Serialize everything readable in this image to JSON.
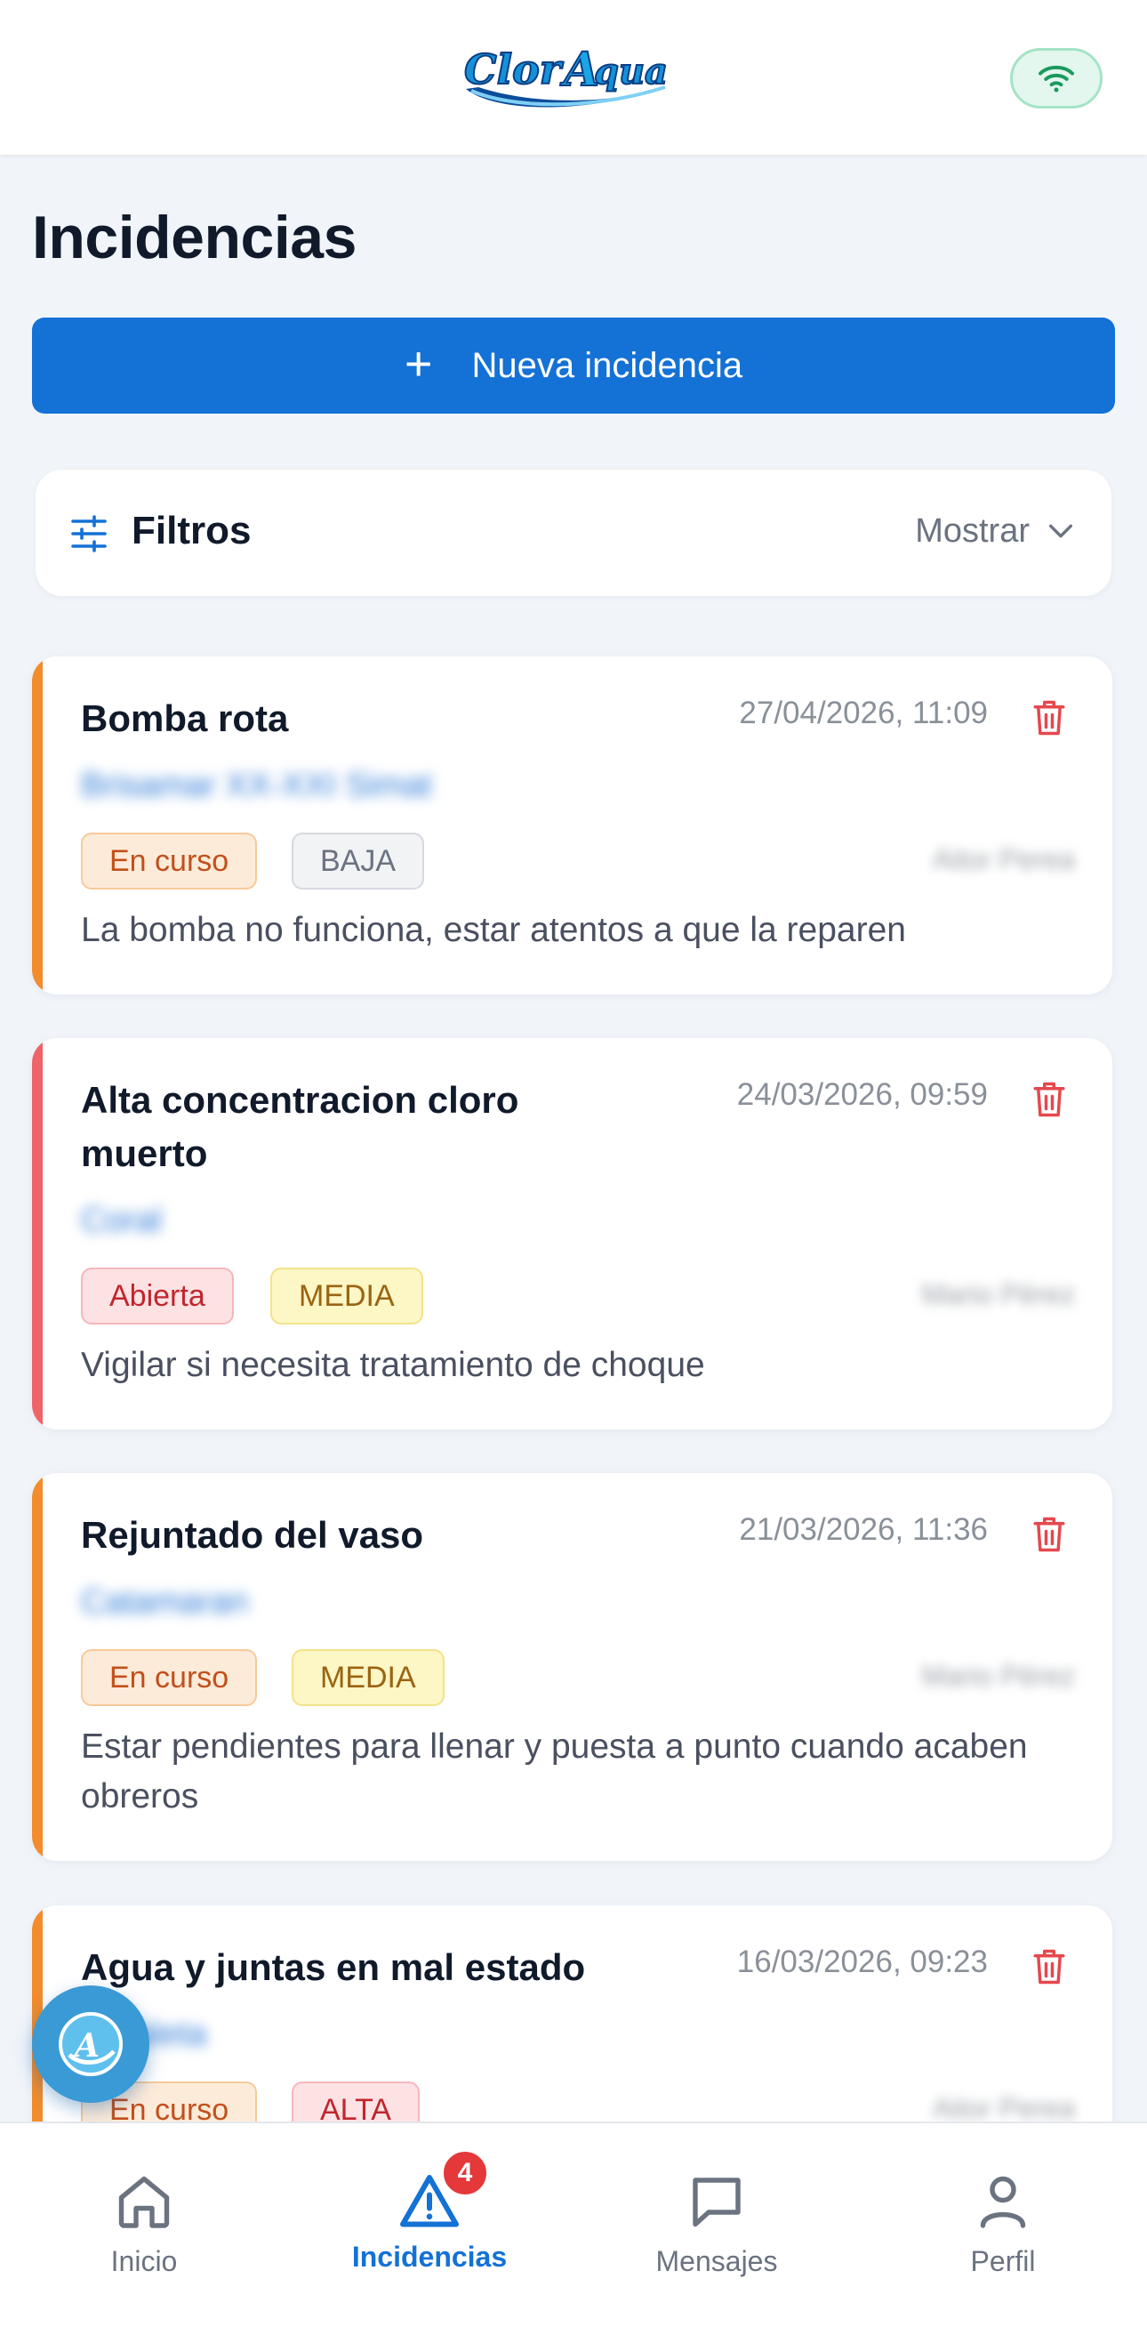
{
  "header": {
    "logo_text": "ClorAqua",
    "wifi_icon": "wifi-icon"
  },
  "page": {
    "title": "Incidencias",
    "new_button_label": "Nueva incidencia"
  },
  "filters": {
    "title": "Filtros",
    "toggle_label": "Mostrar"
  },
  "incidents": [
    {
      "title": "Bomba rota",
      "date": "27/04/2026, 11:09",
      "client": "Brisamar XX-XXI Simat",
      "status": "En curso",
      "priority": "BAJA",
      "assignee": "Aitor Perea",
      "description": "La bomba no funciona, estar atentos a que la reparen"
    },
    {
      "title": "Alta concentracion cloro muerto",
      "date": "24/03/2026, 09:59",
      "client": "Coral",
      "status": "Abierta",
      "priority": "MEDIA",
      "assignee": "Mario Pérez",
      "description": "Vigilar si necesita tratamiento de choque"
    },
    {
      "title": "Rejuntado del vaso",
      "date": "21/03/2026, 11:36",
      "client": "Catamaran",
      "status": "En curso",
      "priority": "MEDIA",
      "assignee": "Mario Pérez",
      "description": "Estar pendientes para llenar y puesta a punto cuando acaben obreros"
    },
    {
      "title": "Agua y juntas en mal estado",
      "date": "16/03/2026, 09:23",
      "client": "Cataleta",
      "status": "En curso",
      "priority": "ALTA",
      "assignee": "Aitor Perea",
      "description": ""
    }
  ],
  "nav": {
    "items": [
      {
        "label": "Inicio",
        "icon": "home-icon"
      },
      {
        "label": "Incidencias",
        "icon": "warning-icon",
        "badge": "4"
      },
      {
        "label": "Mensajes",
        "icon": "chat-icon"
      },
      {
        "label": "Perfil",
        "icon": "user-icon"
      }
    ]
  },
  "colors": {
    "primary": "#1471d6",
    "status_in_progress": "#f28c2c",
    "status_open": "#ef6468",
    "delete": "#e5484d"
  }
}
